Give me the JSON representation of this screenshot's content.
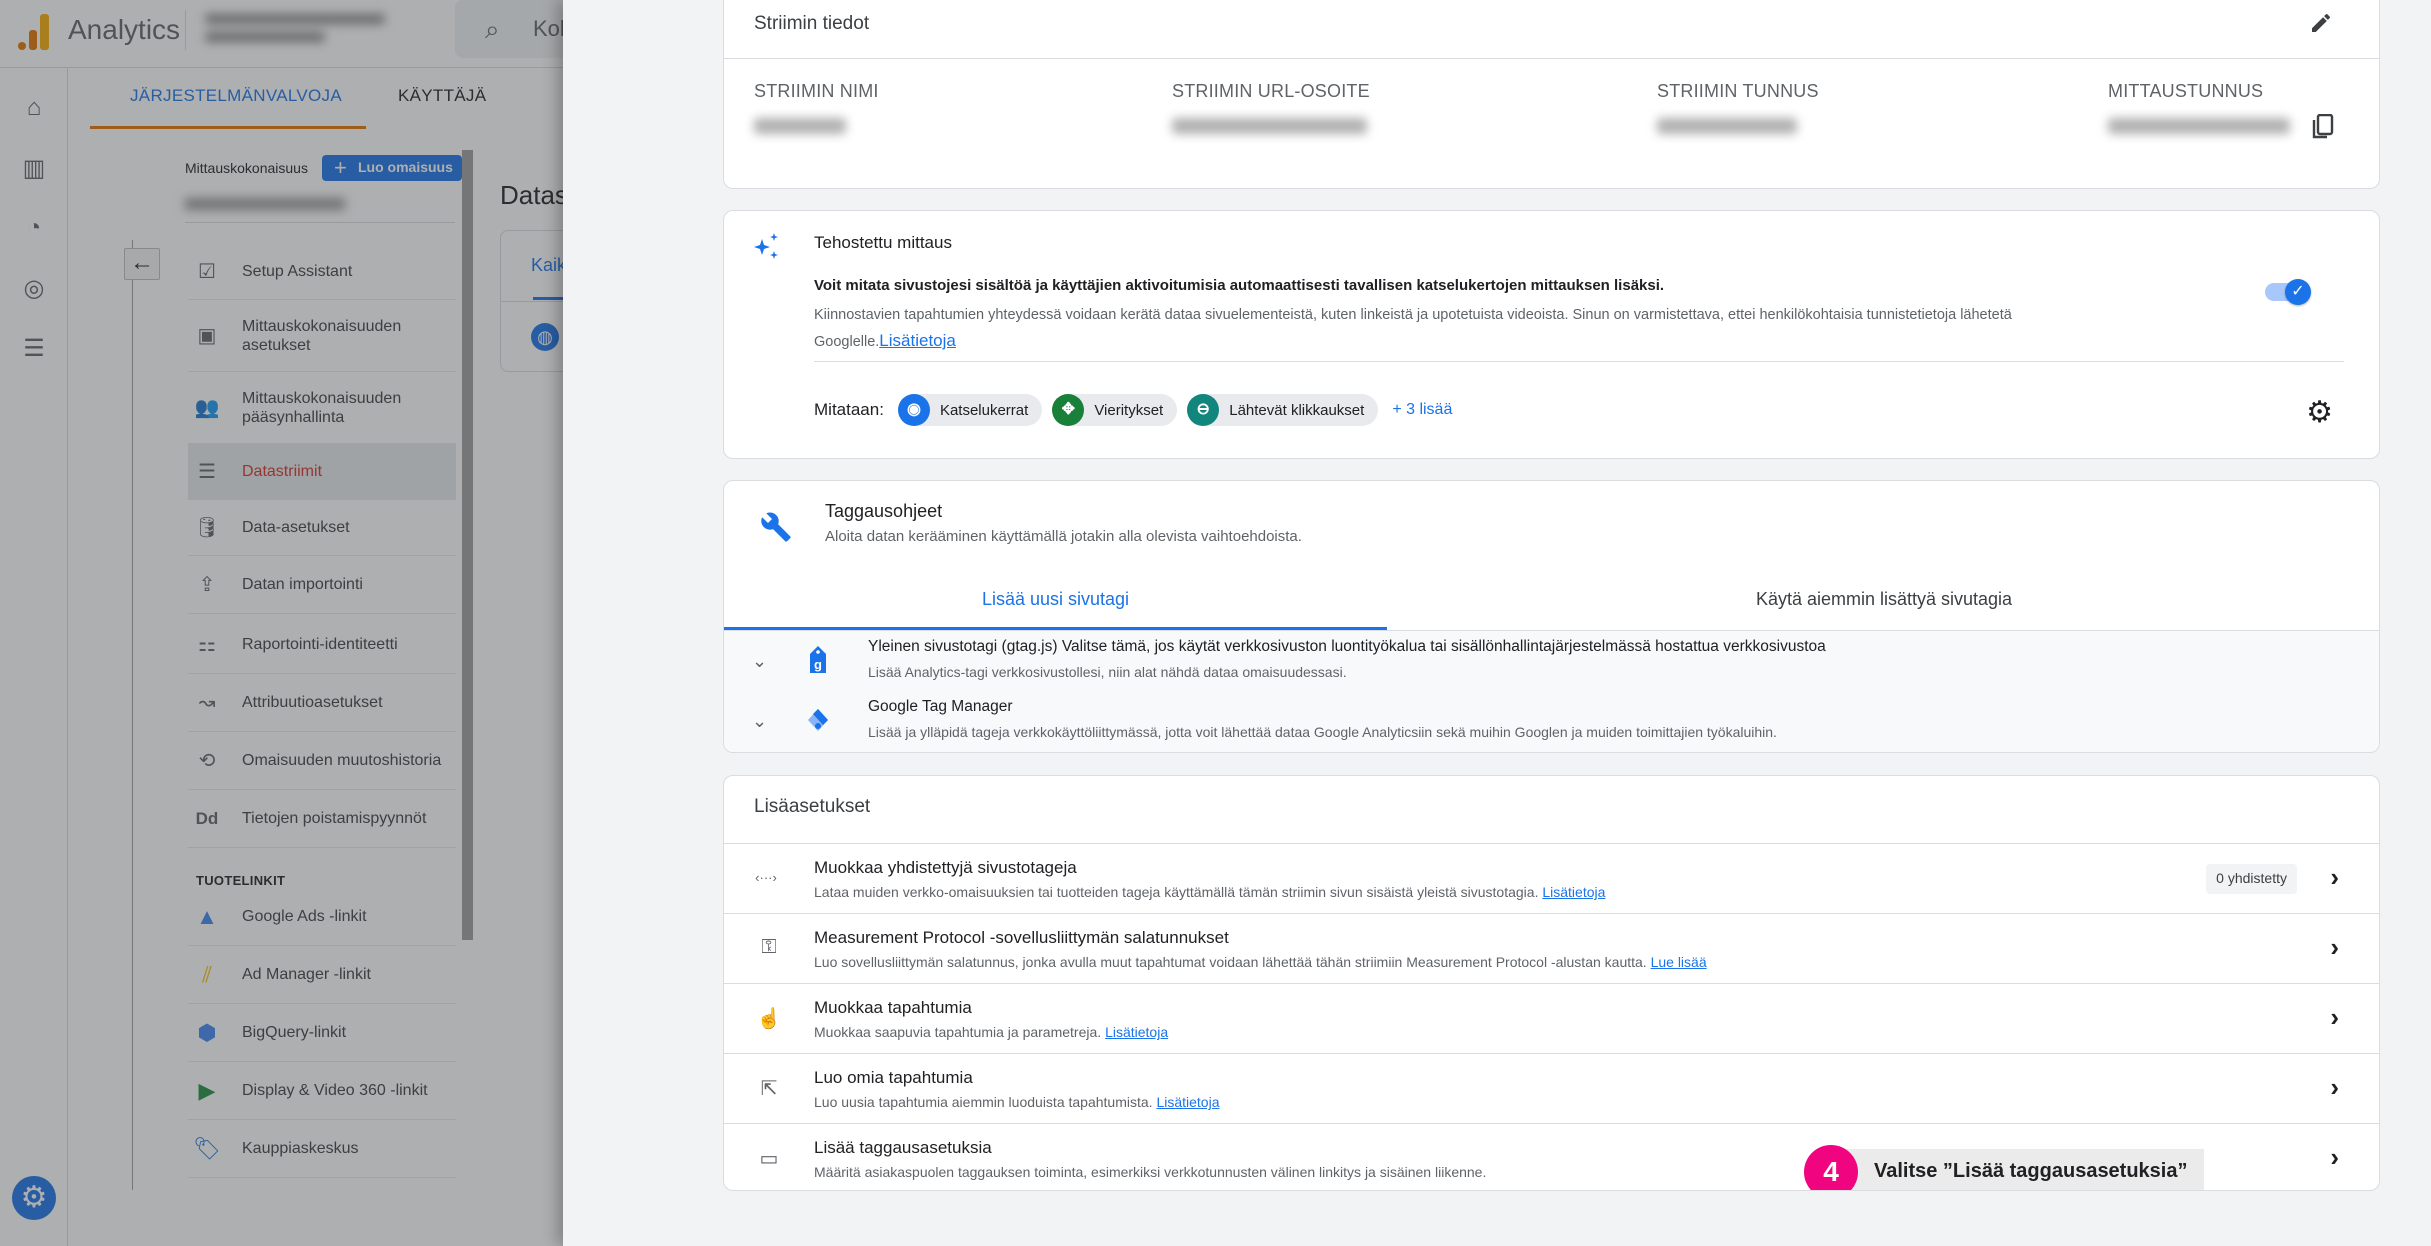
{
  "app": {
    "title": "Analytics",
    "search_placeholder": "Kokeile hakua",
    "search_visible": "Kol"
  },
  "admin_tabs": [
    {
      "label": "JÄRJESTELMÄNVALVOJA",
      "active": true
    },
    {
      "label": "KÄYTTÄJÄ",
      "active": false
    }
  ],
  "property": {
    "label": "Mittauskokonaisuus",
    "create_button": "Luo omaisuus"
  },
  "nav": {
    "items": [
      {
        "label": "Setup Assistant",
        "icon": "clipboard-check-icon",
        "glyph": "☑"
      },
      {
        "label": "Mittauskokonaisuuden asetukset",
        "icon": "layout-icon",
        "glyph": "▣"
      },
      {
        "label": "Mittauskokonaisuuden pääsynhallinta",
        "icon": "people-icon",
        "glyph": "👥"
      },
      {
        "label": "Datastriimit",
        "icon": "streams-icon",
        "glyph": "☰",
        "selected": true
      },
      {
        "label": "Data-asetukset",
        "icon": "database-icon",
        "glyph": "🛢"
      },
      {
        "label": "Datan importointi",
        "icon": "upload-icon",
        "glyph": "⇪"
      },
      {
        "label": "Raportointi-identiteetti",
        "icon": "reporting-identity-icon",
        "glyph": "⚏"
      },
      {
        "label": "Attribuutioasetukset",
        "icon": "attribution-icon",
        "glyph": "↝"
      },
      {
        "label": "Omaisuuden muutoshistoria",
        "icon": "history-icon",
        "glyph": "⟲"
      },
      {
        "label": "Tietojen poistamispyynnöt",
        "icon": "data-deletion-icon",
        "glyph": "Dd"
      }
    ],
    "products_heading": "TUOTELINKIT",
    "products": [
      {
        "label": "Google Ads -linkit",
        "icon": "google-ads-icon",
        "glyph": "▲",
        "color": "#4285f4"
      },
      {
        "label": "Ad Manager -linkit",
        "icon": "ad-manager-icon",
        "glyph": "⫽",
        "color": "#fbbc04"
      },
      {
        "label": "BigQuery-linkit",
        "icon": "bigquery-icon",
        "glyph": "⬢",
        "color": "#4285f4"
      },
      {
        "label": "Display & Video 360 -linkit",
        "icon": "dv360-icon",
        "glyph": "▶",
        "color": "#1e8e3e"
      },
      {
        "label": "Kauppiaskeskus",
        "icon": "merchant-center-icon",
        "glyph": "🏷",
        "color": "#1a73e8"
      }
    ]
  },
  "datastreams_bg": {
    "title": "Datas",
    "tab": "Kaik"
  },
  "stream_details": {
    "title": "Striimin tiedot",
    "fields": [
      {
        "label": "STRIIMIN NIMI",
        "value": "[blurred]"
      },
      {
        "label": "STRIIMIN URL-OSOITE",
        "value": "[blurred]"
      },
      {
        "label": "STRIIMIN TUNNUS",
        "value": "[blurred]"
      },
      {
        "label": "MITTAUSTUNNUS",
        "value": "[blurred]"
      }
    ]
  },
  "enhanced": {
    "title": "Tehostettu mittaus",
    "lead": "Voit mitata sivustojesi sisältöä ja käyttäjien aktivoitumisia automaattisesti tavallisen katselukertojen mittauksen lisäksi.",
    "desc": "Kiinnostavien tapahtumien yhteydessä voidaan kerätä dataa sivuelementeistä, kuten linkeistä ja upotetuista videoista. Sinun on varmistettava, ettei henkilökohtaisia tunnistetietoja lähetetä Googlelle.",
    "link": "Lisätietoja",
    "enabled": true,
    "measured_label": "Mitataan:",
    "chips": [
      {
        "label": "Katselukerrat",
        "icon": "eye-icon",
        "glyph": "◉",
        "color": "#1a73e8"
      },
      {
        "label": "Vieritykset",
        "icon": "scroll-icon",
        "glyph": "✥",
        "color": "#188038"
      },
      {
        "label": "Lähtevät klikkaukset",
        "icon": "mouse-icon",
        "glyph": "⊖",
        "color": "#12857d"
      }
    ],
    "more": "+ 3 lisää"
  },
  "tagging": {
    "title": "Taggausohjeet",
    "subtitle": "Aloita datan kerääminen käyttämällä jotakin alla olevista vaihtoehdoista.",
    "tabs": [
      {
        "label": "Lisää uusi sivutagi",
        "active": true
      },
      {
        "label": "Käytä aiemmin lisättyä sivutagia",
        "active": false
      }
    ],
    "options": [
      {
        "title_bold": "Yleinen sivustotagi (gtag.js)",
        "title_rest": " Valitse tämä, jos käytät verkkosivuston luontityökalua tai sisällönhallintajärjestelmässä hostattua verkkosivustoa",
        "desc": "Lisää Analytics-tagi verkkosivustollesi, niin alat nähdä dataa omaisuudessasi."
      },
      {
        "title_bold": "Google Tag Manager",
        "title_rest": "",
        "desc": "Lisää ja ylläpidä tageja verkkokäyttöliittymässä, jotta voit lähettää dataa Google Analyticsiin sekä muihin Googlen ja muiden toimittajien työkaluihin."
      }
    ]
  },
  "additional": {
    "title": "Lisäasetukset",
    "rows": [
      {
        "title": "Muokkaa yhdistettyjä sivustotageja",
        "desc": "Lataa muiden verkko-omaisuuksien tai tuotteiden tageja käyttämällä tämän striimin sivun sisäistä yleistä sivustotagia.",
        "link": "Lisätietoja",
        "badge": "0 yhdistetty",
        "icon": "code-icon",
        "glyph": "‹···›"
      },
      {
        "title": "Measurement Protocol -sovellusliittymän salatunnukset",
        "desc": "Luo sovellusliittymän salatunnus, jonka avulla muut tapahtumat voidaan lähettää tähän striimiin Measurement Protocol -alustan kautta.",
        "link": "Lue lisää",
        "badge": "",
        "icon": "key-icon",
        "glyph": "⚿"
      },
      {
        "title": "Muokkaa tapahtumia",
        "desc": "Muokkaa saapuvia tapahtumia ja parametreja.",
        "link": "Lisätietoja",
        "badge": "",
        "icon": "touch-icon",
        "glyph": "☝"
      },
      {
        "title": "Luo omia tapahtumia",
        "desc": "Luo uusia tapahtumia aiemmin luoduista tapahtumista.",
        "link": "Lisätietoja",
        "badge": "",
        "icon": "click-icon",
        "glyph": "⇱"
      },
      {
        "title": "Lisää taggausasetuksia",
        "desc": "Määritä asiakaspuolen taggauksen toiminta, esimerkiksi verkkotunnusten välinen linkitys ja sisäinen liikenne.",
        "link": "",
        "badge": "",
        "icon": "label-icon",
        "glyph": "▭"
      }
    ]
  },
  "callout": {
    "step": "4",
    "text": "Valitse ”Lisää taggausasetuksia”",
    "color": "#f0047f"
  }
}
